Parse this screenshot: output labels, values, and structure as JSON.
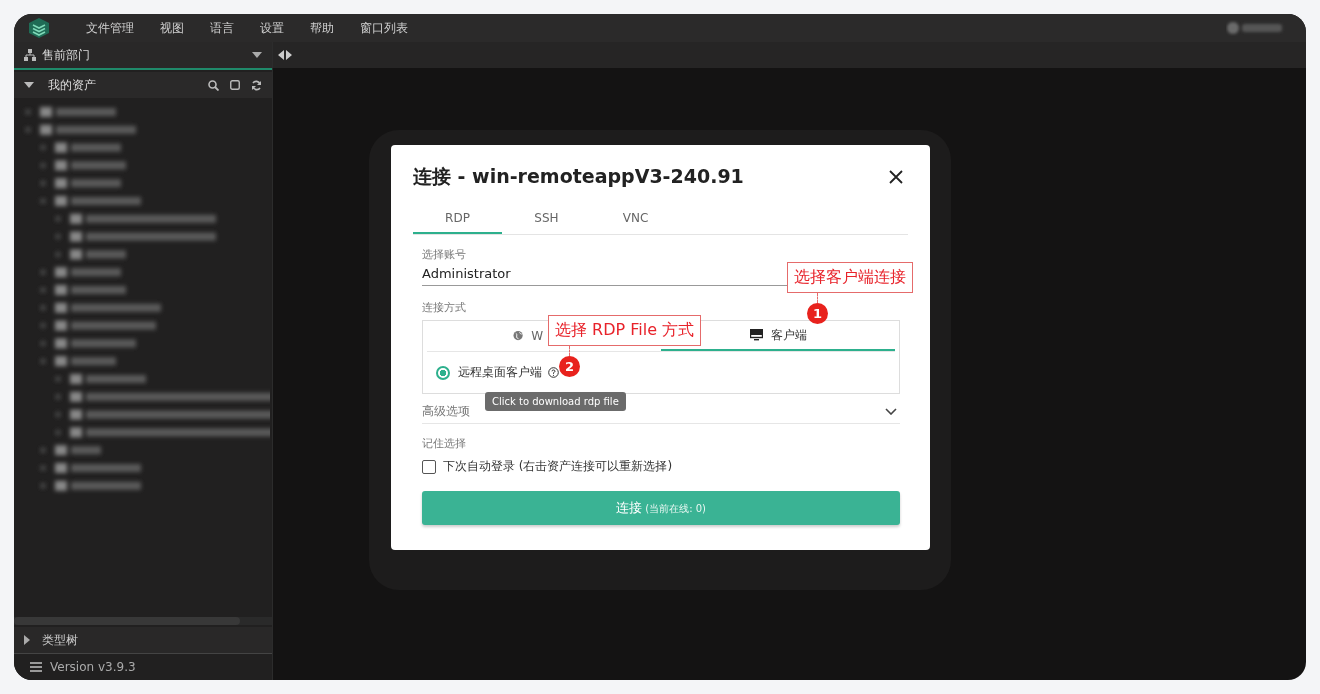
{
  "menu": [
    "文件管理",
    "视图",
    "语言",
    "设置",
    "帮助",
    "窗口列表"
  ],
  "sidebar": {
    "org_select": "售前部门",
    "assets_title": "我的资产",
    "type_tree": "类型树",
    "version": "Version v3.9.3"
  },
  "dialog": {
    "title": "连接 - win-remoteappV3-240.91",
    "protocol_tabs": [
      {
        "label": "RDP",
        "selected": true
      },
      {
        "label": "SSH",
        "selected": false
      },
      {
        "label": "VNC",
        "selected": false
      }
    ],
    "account_label": "选择账号",
    "account_value": "Administrator",
    "method_label": "连接方式",
    "method_tabs": [
      {
        "label": "W",
        "kind": "globe",
        "selected": false
      },
      {
        "label": "客户端",
        "kind": "monitor",
        "selected": true
      }
    ],
    "options": [
      {
        "label": "远程桌面客户端",
        "selected": true
      }
    ],
    "tooltip": "Click to download rdp file",
    "advanced_label": "高级选项",
    "remember_label": "记住选择",
    "auto_login": {
      "label": "下次自动登录 (右击资产连接可以重新选择)",
      "checked": false
    },
    "connect_button": {
      "label": "连接",
      "hint": "(当前在线: 0)"
    }
  },
  "annotations": [
    {
      "number": "1",
      "text": "选择客户端连接"
    },
    {
      "number": "2",
      "text": "选择 RDP File 方式"
    }
  ]
}
